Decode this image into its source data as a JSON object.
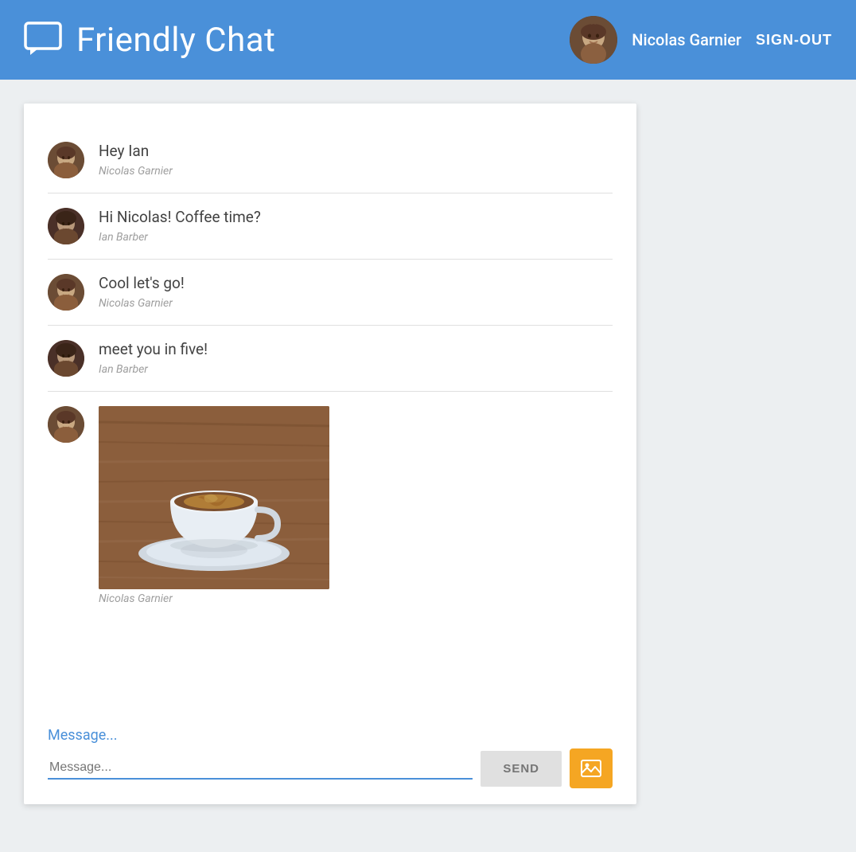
{
  "header": {
    "logo_alt": "Friendly Chat logo",
    "title": "Friendly Chat",
    "user": {
      "name": "Nicolas Garnier",
      "avatar_alt": "Nicolas Garnier avatar"
    },
    "signout_label": "SIGN-OUT"
  },
  "chat": {
    "messages": [
      {
        "id": 1,
        "text": "Hey Ian",
        "author": "Nicolas Garnier",
        "avatar_type": "nicolas",
        "has_image": false
      },
      {
        "id": 2,
        "text": "Hi Nicolas! Coffee time?",
        "author": "Ian Barber",
        "avatar_type": "ian",
        "has_image": false
      },
      {
        "id": 3,
        "text": "Cool let's go!",
        "author": "Nicolas Garnier",
        "avatar_type": "nicolas",
        "has_image": false
      },
      {
        "id": 4,
        "text": "meet you in five!",
        "author": "Ian Barber",
        "avatar_type": "ian",
        "has_image": false
      },
      {
        "id": 5,
        "text": "",
        "author": "Nicolas Garnier",
        "avatar_type": "nicolas",
        "has_image": true
      }
    ],
    "input": {
      "placeholder": "Message...",
      "value": ""
    },
    "send_label": "SEND",
    "image_upload_alt": "Upload image"
  },
  "colors": {
    "header_bg": "#4a90d9",
    "accent": "#4a90d9",
    "send_bg": "#e0e0e0",
    "upload_bg": "#f5a623"
  }
}
